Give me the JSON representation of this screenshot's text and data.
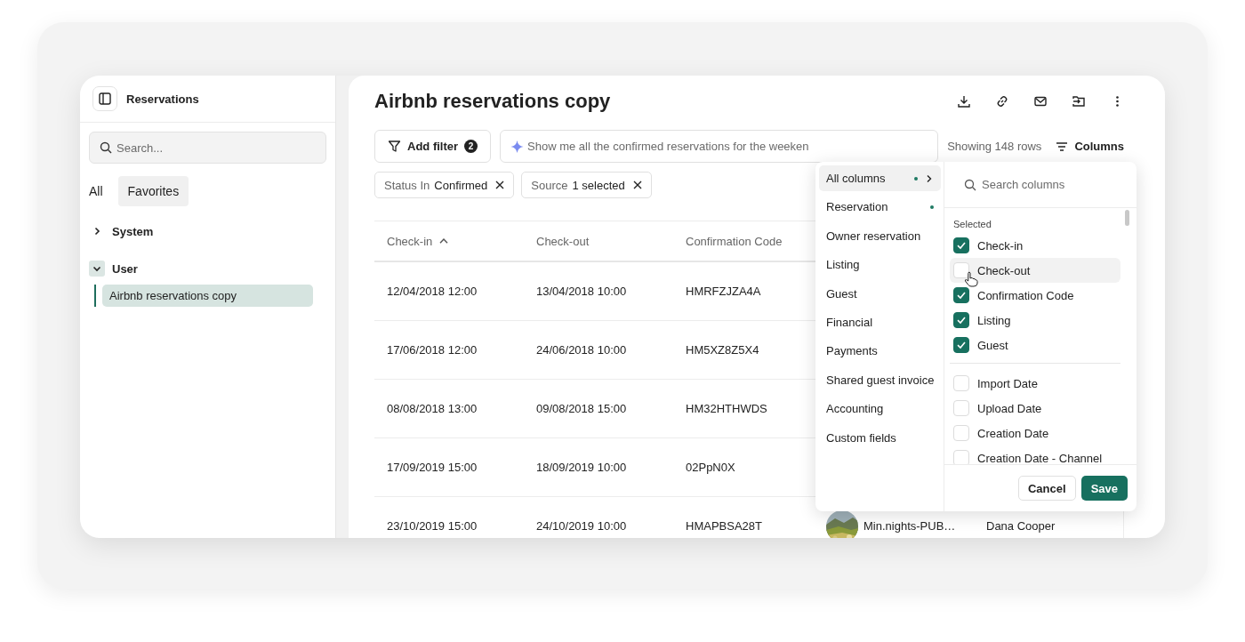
{
  "sidebar": {
    "title": "Reservations",
    "search": {
      "placeholder": "Search..."
    },
    "tabs": [
      {
        "label": "All",
        "selected": false
      },
      {
        "label": "Favorites",
        "selected": true
      }
    ],
    "tree": [
      {
        "label": "System",
        "expanded": false
      },
      {
        "label": "User",
        "expanded": true,
        "children": [
          {
            "label": "Airbnb reservations copy",
            "selected": true
          }
        ]
      }
    ]
  },
  "main": {
    "title": "Airbnb reservations copy",
    "add_filter": {
      "label": "Add filter",
      "count": "2"
    },
    "ai_search": {
      "placeholder": "Show me all the confirmed reservations for the weeken"
    },
    "row_count": "Showing 148 rows",
    "columns_button": "Columns",
    "chips": [
      {
        "label": "Status In",
        "value": "Confirmed"
      },
      {
        "label": "Source",
        "value": "1 selected"
      }
    ],
    "table": {
      "columns": [
        {
          "label": "Check-in",
          "sorted": true
        },
        {
          "label": "Check-out",
          "sorted": false
        },
        {
          "label": "Confirmation Code",
          "sorted": false
        }
      ],
      "rows": [
        {
          "cells": [
            "12/04/2018 12:00",
            "13/04/2018 10:00",
            "HMRFZJZA4A"
          ]
        },
        {
          "cells": [
            "17/06/2018 12:00",
            "24/06/2018 10:00",
            "HM5XZ8Z5X4"
          ]
        },
        {
          "cells": [
            "08/08/2018 13:00",
            "09/08/2018 15:00",
            "HM32HTHWDS"
          ]
        },
        {
          "cells": [
            "17/09/2019 15:00",
            "18/09/2019 10:00",
            "02PpN0X"
          ]
        },
        {
          "cells": [
            "23/10/2019 15:00",
            "24/10/2019 10:00",
            "HMAPBSA28T"
          ],
          "listing": {
            "kind": "picture",
            "name": "Min.nights-PUB…"
          },
          "guest": "Dana Cooper"
        }
      ]
    }
  },
  "columns_panel": {
    "groups": [
      {
        "label": "All columns",
        "selected": true,
        "dot": true,
        "chevron": true
      },
      {
        "label": "Reservation",
        "selected": false,
        "dot": true,
        "chevron": false
      },
      {
        "label": "Owner reservation",
        "selected": false,
        "dot": false,
        "chevron": false
      },
      {
        "label": "Listing",
        "selected": false,
        "dot": false,
        "chevron": false
      },
      {
        "label": "Guest",
        "selected": false,
        "dot": false,
        "chevron": false
      },
      {
        "label": "Financial",
        "selected": false,
        "dot": false,
        "chevron": false
      },
      {
        "label": "Payments",
        "selected": false,
        "dot": false,
        "chevron": false
      },
      {
        "label": "Shared guest invoice",
        "selected": false,
        "dot": false,
        "chevron": false
      },
      {
        "label": "Accounting",
        "selected": false,
        "dot": false,
        "chevron": false
      },
      {
        "label": "Custom fields",
        "selected": false,
        "dot": false,
        "chevron": false
      }
    ],
    "search": {
      "placeholder": "Search columns"
    },
    "selected_heading": "Selected",
    "selected": [
      {
        "label": "Check-in",
        "checked": true,
        "hovered": false
      },
      {
        "label": "Check-out",
        "checked": false,
        "hovered": true
      },
      {
        "label": "Confirmation Code",
        "checked": true,
        "hovered": false
      },
      {
        "label": "Listing",
        "checked": true,
        "hovered": false
      },
      {
        "label": "Guest",
        "checked": true,
        "hovered": false
      }
    ],
    "others": [
      {
        "label": "Import Date",
        "checked": false,
        "hovered": false
      },
      {
        "label": "Upload Date",
        "checked": false,
        "hovered": false
      },
      {
        "label": "Creation Date",
        "checked": false,
        "hovered": false
      },
      {
        "label": "Creation Date - Channel",
        "checked": false,
        "hovered": false
      }
    ],
    "buttons": {
      "cancel": "Cancel",
      "save": "Save"
    }
  }
}
